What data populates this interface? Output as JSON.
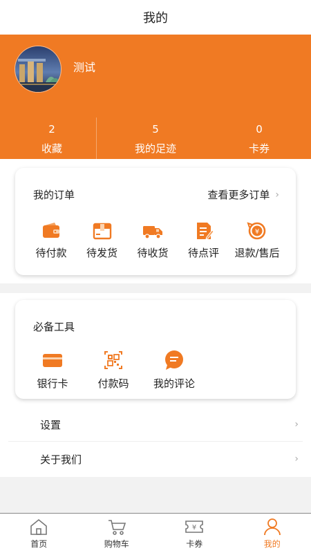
{
  "header": {
    "title": "我的"
  },
  "profile": {
    "name": "测试"
  },
  "stats": [
    {
      "count": "2",
      "label": "收藏"
    },
    {
      "count": "5",
      "label": "我的足迹"
    },
    {
      "count": "0",
      "label": "卡券"
    }
  ],
  "orders": {
    "title": "我的订单",
    "more_label": "查看更多订单",
    "items": [
      {
        "label": "待付款",
        "icon": "wallet-icon"
      },
      {
        "label": "待发货",
        "icon": "package-icon"
      },
      {
        "label": "待收货",
        "icon": "truck-icon"
      },
      {
        "label": "待点评",
        "icon": "review-icon"
      },
      {
        "label": "退款/售后",
        "icon": "refund-icon"
      }
    ]
  },
  "tools": {
    "title": "必备工具",
    "items": [
      {
        "label": "银行卡",
        "icon": "bank-card-icon"
      },
      {
        "label": "付款码",
        "icon": "payment-code-icon"
      },
      {
        "label": "我的评论",
        "icon": "comment-icon"
      }
    ]
  },
  "menu": [
    {
      "label": "设置"
    },
    {
      "label": "关于我们"
    }
  ],
  "tabs": [
    {
      "label": "首页",
      "icon": "home-icon"
    },
    {
      "label": "购物车",
      "icon": "cart-icon"
    },
    {
      "label": "卡券",
      "icon": "coupon-icon"
    },
    {
      "label": "我的",
      "icon": "user-icon",
      "active": true
    }
  ],
  "colors": {
    "accent": "#f07a23",
    "background": "#f2f2f2"
  }
}
